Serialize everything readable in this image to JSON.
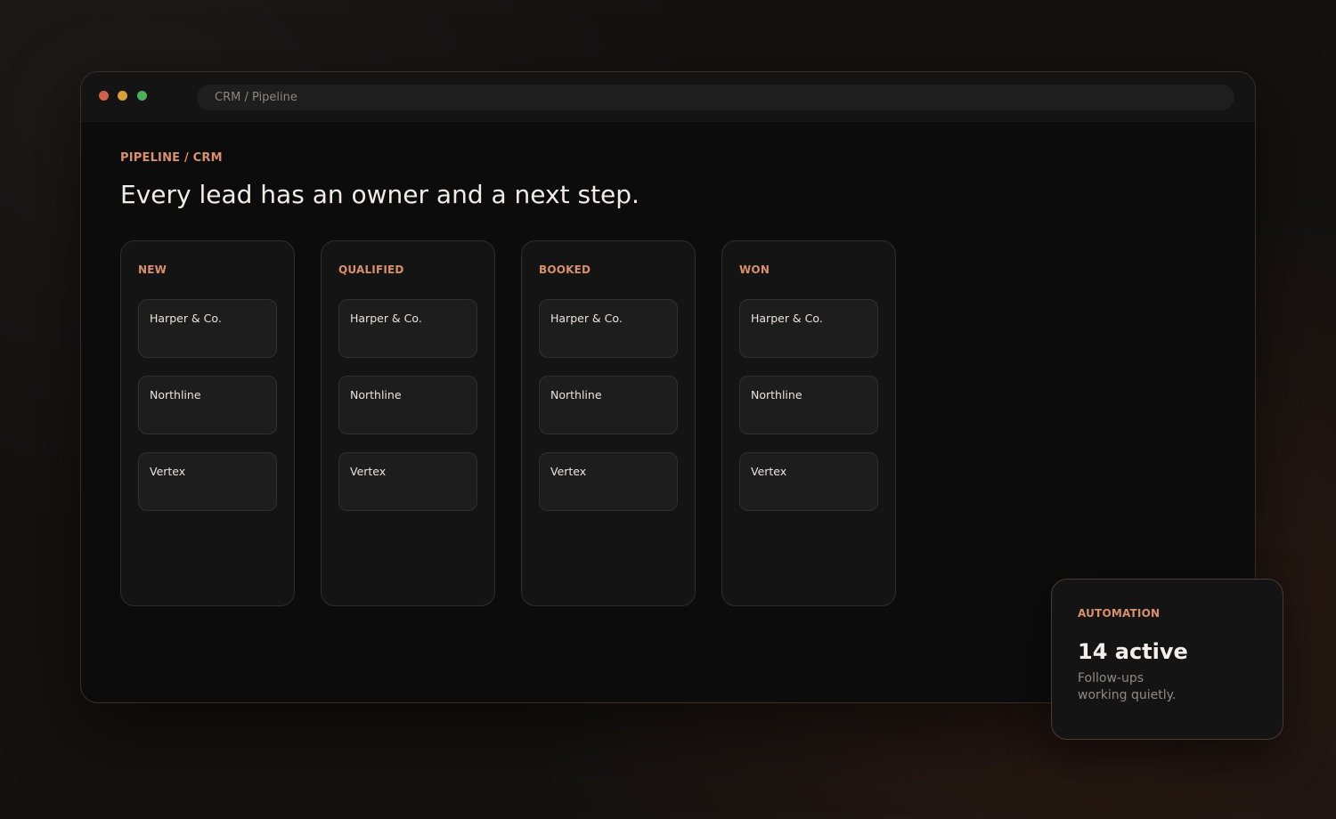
{
  "browser": {
    "address": "CRM / Pipeline"
  },
  "page": {
    "eyebrow": "PIPELINE / CRM",
    "headline": "Every lead has an owner and a next step."
  },
  "columns": [
    {
      "title": "NEW",
      "cards": [
        "Harper & Co.",
        "Northline",
        "Vertex"
      ]
    },
    {
      "title": "QUALIFIED",
      "cards": [
        "Harper & Co.",
        "Northline",
        "Vertex"
      ]
    },
    {
      "title": "BOOKED",
      "cards": [
        "Harper & Co.",
        "Northline",
        "Vertex"
      ]
    },
    {
      "title": "WON",
      "cards": [
        "Harper & Co.",
        "Northline",
        "Vertex"
      ]
    }
  ],
  "automation": {
    "label": "AUTOMATION",
    "value": "14 active",
    "description": "Follow-ups working quietly."
  },
  "colors": {
    "accent": "#d9906c",
    "window_bg": "#0c0c0c",
    "column_bg": "#141414",
    "card_bg": "#1d1d1d",
    "close": "#d0604d",
    "minimize": "#d7a13a",
    "maximize": "#4fae5a"
  }
}
